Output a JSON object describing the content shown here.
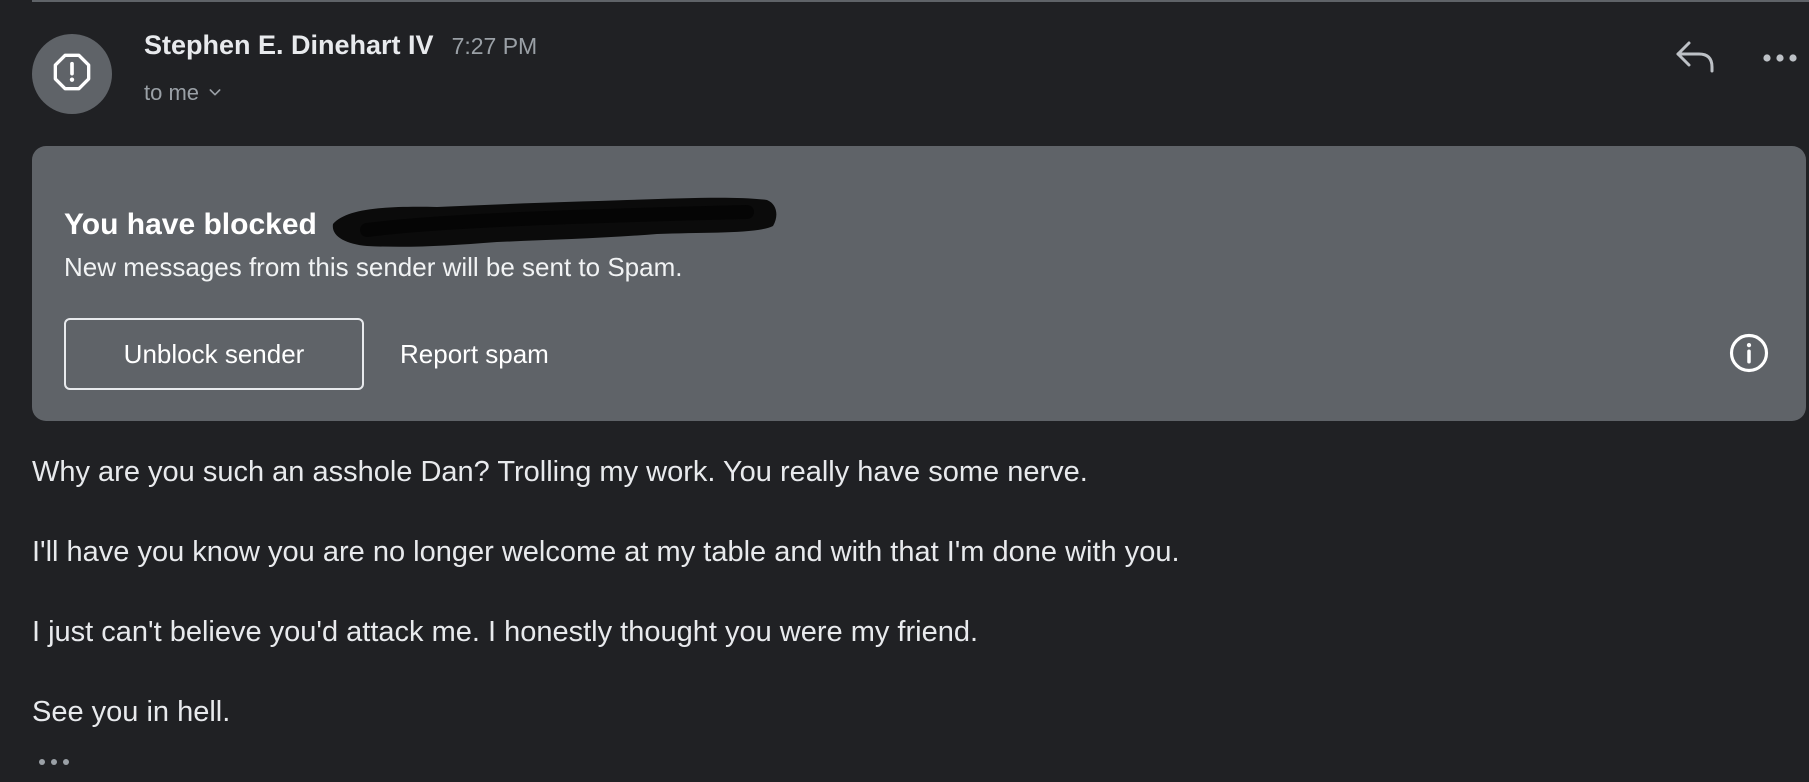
{
  "message": {
    "sender_name": "Stephen E. Dinehart IV",
    "time": "7:27 PM",
    "recipient": "to me",
    "avatar_icon": "alert-octagon-icon"
  },
  "actions": {
    "reply_icon": "reply-icon",
    "more_icon": "more-horizontal-icon"
  },
  "block_banner": {
    "title": "You have blocked",
    "subtitle": "New messages from this sender will be sent to Spam.",
    "unblock_label": "Unblock sender",
    "report_label": "Report spam",
    "info_icon": "info-icon",
    "background_color": "#5f6368"
  },
  "body": {
    "paragraphs": [
      "Why are you such an asshole Dan? Trolling my work. You really have some nerve.",
      "I'll have you know you are no longer welcome at my table and with that I'm done with you.",
      "I just can't believe you'd attack me. I honestly thought you were my friend.",
      "See you in hell."
    ]
  },
  "theme": {
    "background": "#202124",
    "text_primary": "#e8eaed",
    "text_secondary": "#9aa0a6"
  }
}
